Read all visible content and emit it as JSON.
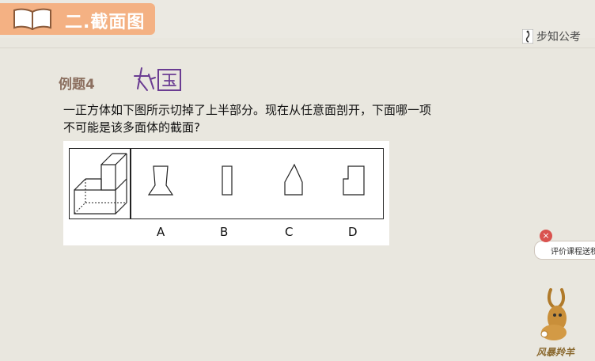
{
  "header": {
    "section_title": "二.截面图",
    "brand": "步知公考"
  },
  "example": {
    "label": "例题4",
    "handwriting": "如图"
  },
  "question": {
    "text": "一正方体如下图所示切掉了上半部分。现在从任意面剖开，下面哪一项不可能是该多面体的截面?"
  },
  "options": [
    "A",
    "B",
    "C",
    "D"
  ],
  "overlay": {
    "rating_text": "评价课程送积分",
    "close_symbol": "×"
  },
  "logo": {
    "text": "风暴羚羊"
  },
  "colors": {
    "title_bar": "#f4b183",
    "background": "#e9e7df",
    "example_label": "#8c7060"
  }
}
